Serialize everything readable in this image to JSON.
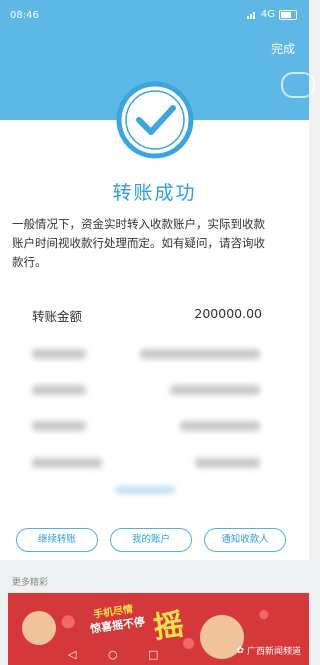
{
  "status_bar": {
    "time": "08:46",
    "network": "4G"
  },
  "header": {
    "done_label": "完成"
  },
  "result": {
    "title": "转账成功",
    "notice": "一般情况下，资金实时转入收款账户，实际到收款账户时间视收款行处理而定。如有疑问，请咨询收款行。"
  },
  "details": {
    "amount_label": "转账金额",
    "amount_value": "200000.00"
  },
  "actions": {
    "continue_label": "继续转账",
    "my_account_label": "我的账户",
    "notify_label": "通知收款人"
  },
  "more": {
    "section_title": "更多精彩"
  },
  "banner": {
    "line1": "手机尽情",
    "line2": "惊喜摇不停",
    "big": "摇"
  },
  "watermark": {
    "text": "广西新闻频道"
  },
  "colors": {
    "accent": "#5eb8e6",
    "title": "#2b9fd9",
    "banner": "#d4383a"
  }
}
